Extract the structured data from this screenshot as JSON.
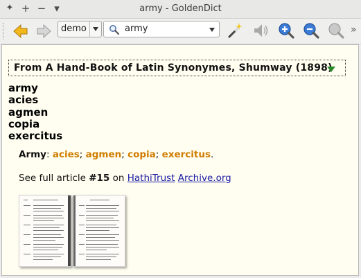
{
  "window": {
    "title": "army - GoldenDict",
    "controls": {
      "menu": "✦",
      "new": "+",
      "minimize": "−",
      "more": "▾"
    }
  },
  "toolbar": {
    "group": "demo",
    "search_value": "army"
  },
  "article": {
    "dictionary_title": "From A Hand-Book of Latin Synonymes, Shumway (1898)",
    "headwords": [
      "army",
      "acies",
      "agmen",
      "copia",
      "exercitus"
    ],
    "definition": {
      "term": "Army",
      "separator": ": ",
      "synonyms": [
        "acies",
        "agmen",
        "copia",
        "exercitus"
      ],
      "sep": "; ",
      "end": "."
    },
    "full_article": {
      "prefix": "See full article ",
      "number": "#15",
      "middle": " on ",
      "link1": "HathiTrust",
      "link2": "Archive.org"
    }
  },
  "colors": {
    "synonym": "#d07c00",
    "link": "#1a1aa6",
    "background": "#fffef0",
    "toggle": "#2a8a2a"
  }
}
